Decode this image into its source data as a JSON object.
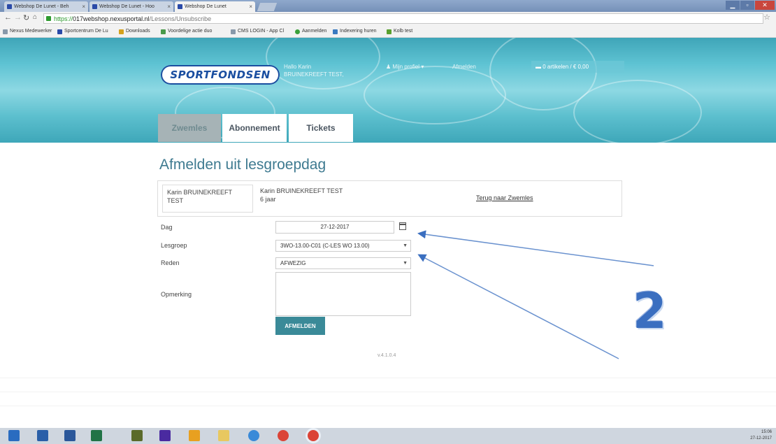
{
  "browser": {
    "tabs": [
      {
        "label": "Webshop De Lunet - Beh"
      },
      {
        "label": "Webshop De Lunet - Hoo"
      },
      {
        "label": "Webshop De Lunet"
      }
    ],
    "url_prefix": "https://",
    "url_host": "017webshop.nexusportal.nl",
    "url_path": "/Lessons/Unsubscribe",
    "bookmarks": [
      "Nexus Medewerker",
      "Sportcentrum De Lu",
      "Downloads",
      "Voordelige actie duo",
      "CMS LOGIN - App Cl",
      "Aanmelden",
      "Indexering huren",
      "Kolb test"
    ]
  },
  "header": {
    "logo_text": "SPORTFONDSEN",
    "hello_line1": "Hallo Karin",
    "hello_line2": "BRUINEKREEFT TEST,",
    "profile_link": "Mijn profiel",
    "logout_link": "Afmelden",
    "cart_text": "0 artikelen / € 0,00"
  },
  "nav_tabs": [
    "Zwemles",
    "Abonnement",
    "Tickets"
  ],
  "main": {
    "title": "Afmelden uit lesgroepdag",
    "person_box_line1": "Karin BRUINEKREEFT",
    "person_box_line2": "TEST",
    "person_name": "Karin BRUINEKREEFT TEST",
    "person_age": "6 jaar",
    "back_link": "Terug naar Zwemles"
  },
  "form": {
    "dag_label": "Dag",
    "dag_value": "27-12-2017",
    "lesgroep_label": "Lesgroep",
    "lesgroep_value": "3WO-13.00-C01 (C-LES WO 13.00)",
    "reden_label": "Reden",
    "reden_value": "AFWEZIG",
    "opmerking_label": "Opmerking",
    "submit_label": "AFMELDEN"
  },
  "version": "v.4.1.0.4",
  "annotation_number": "2",
  "taskbar": {
    "time": "15:06",
    "date": "27-12-2017"
  },
  "colors": {
    "accent": "#3a8a98",
    "title": "#3e7a90",
    "annotation": "#3b6fc0"
  }
}
